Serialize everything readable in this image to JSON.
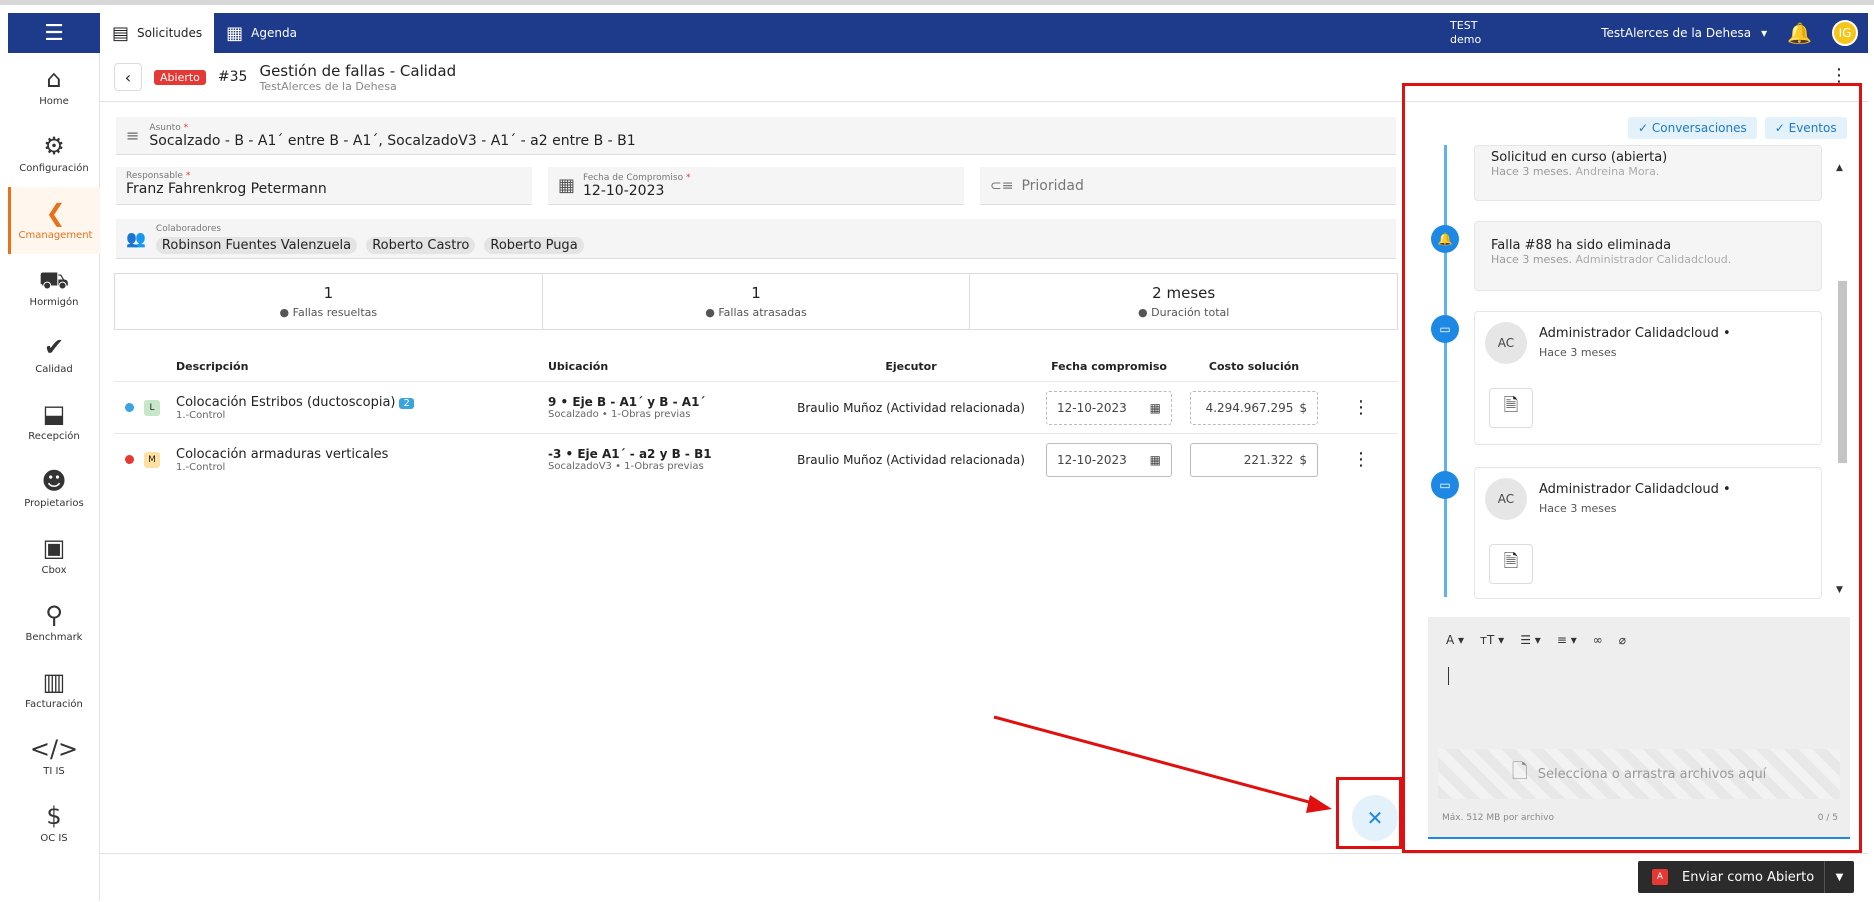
{
  "topbar": {
    "tabs": [
      {
        "label": "Solicitudes",
        "icon": "list-icon"
      },
      {
        "label": "Agenda",
        "icon": "calendar-icon"
      }
    ],
    "env_line1": "TEST",
    "env_line2": "demo",
    "company": "TestAlerces de la Dehesa",
    "user_initials": "IG"
  },
  "sidebar": {
    "items": [
      {
        "label": "Home"
      },
      {
        "label": "Configuración"
      },
      {
        "label": "Cmanagement"
      },
      {
        "label": "Hormigón"
      },
      {
        "label": "Calidad"
      },
      {
        "label": "Recepción"
      },
      {
        "label": "Propietarios"
      },
      {
        "label": "Cbox"
      },
      {
        "label": "Benchmark"
      },
      {
        "label": "Facturación"
      },
      {
        "label": "TI IS"
      },
      {
        "label": "OC IS"
      }
    ],
    "active": "Cmanagement"
  },
  "header": {
    "status": "Abierto",
    "number": "#35",
    "title": "Gestión de fallas - Calidad",
    "subtitle": "TestAlerces de la Dehesa"
  },
  "form": {
    "asunto_label": "Asunto",
    "asunto_value": "Socalzado - B - A1´ entre B - A1´, SocalzadoV3 - A1´ - a2 entre B - B1",
    "responsable_label": "Responsable",
    "responsable_value": "Franz Fahrenkrog Petermann",
    "fecha_label": "Fecha de Compromiso",
    "fecha_value": "12-10-2023",
    "prioridad_placeholder": "Prioridad",
    "colaboradores_label": "Colaboradores",
    "colaboradores": [
      "Robinson Fuentes Valenzuela",
      "Roberto Castro",
      "Roberto Puga"
    ]
  },
  "stats": [
    {
      "value": "1",
      "label": "Fallas resueltas"
    },
    {
      "value": "1",
      "label": "Fallas atrasadas"
    },
    {
      "value": "2 meses",
      "label": "Duración total"
    }
  ],
  "table": {
    "headers": {
      "descripcion": "Descripción",
      "ubicacion": "Ubicación",
      "ejecutor": "Ejecutor",
      "fecha": "Fecha compromiso",
      "costo": "Costo solución"
    },
    "rows": [
      {
        "dot_color": "#3ba3e0",
        "level": "L",
        "level_color": "#c8e6c9",
        "desc": "Colocación Estribos (ductoscopia)",
        "count": "2",
        "desc_sub": "1.-Control",
        "ubic": "9 • Eje B - A1´ y B - A1´",
        "ubic_sub": "Socalzado • 1-Obras previas",
        "ejecutor": "Braulio Muñoz (Actividad relacionada)",
        "fecha": "12-10-2023",
        "costo": "4.294.967.295",
        "currency": "$"
      },
      {
        "dot_color": "#e53935",
        "level": "M",
        "level_color": "#ffe0a3",
        "desc": "Colocación armaduras verticales",
        "count": "",
        "desc_sub": "1.-Control",
        "ubic": "-3 • Eje A1´ - a2 y B - B1",
        "ubic_sub": "SocalzadoV3 • 1-Obras previas",
        "ejecutor": "Braulio Muñoz (Actividad relacionada)",
        "fecha": "12-10-2023",
        "costo": "221.322",
        "currency": "$"
      }
    ]
  },
  "panel": {
    "toggle_conversaciones": "Conversaciones",
    "toggle_eventos": "Eventos",
    "events": [
      {
        "title": "Solicitud en curso (abierta)",
        "time": "Hace 3 meses.",
        "author": "Andreina Mora."
      },
      {
        "title": "Falla #88 ha sido eliminada",
        "time": "Hace 3 meses.",
        "author": "Administrador Calidadcloud."
      }
    ],
    "messages": [
      {
        "initials": "AC",
        "name": "Administrador Calidadcloud  •",
        "time": "Hace 3 meses"
      },
      {
        "initials": "AC",
        "name": "Administrador Calidadcloud  •",
        "time": "Hace 3 meses"
      }
    ],
    "drop_text": "Selecciona o arrastra archivos aquí",
    "max_text": "Máx. 512 MB por archivo",
    "file_count": "0 / 5"
  },
  "footer": {
    "send_badge": "A",
    "send_label": "Enviar como Abierto"
  }
}
